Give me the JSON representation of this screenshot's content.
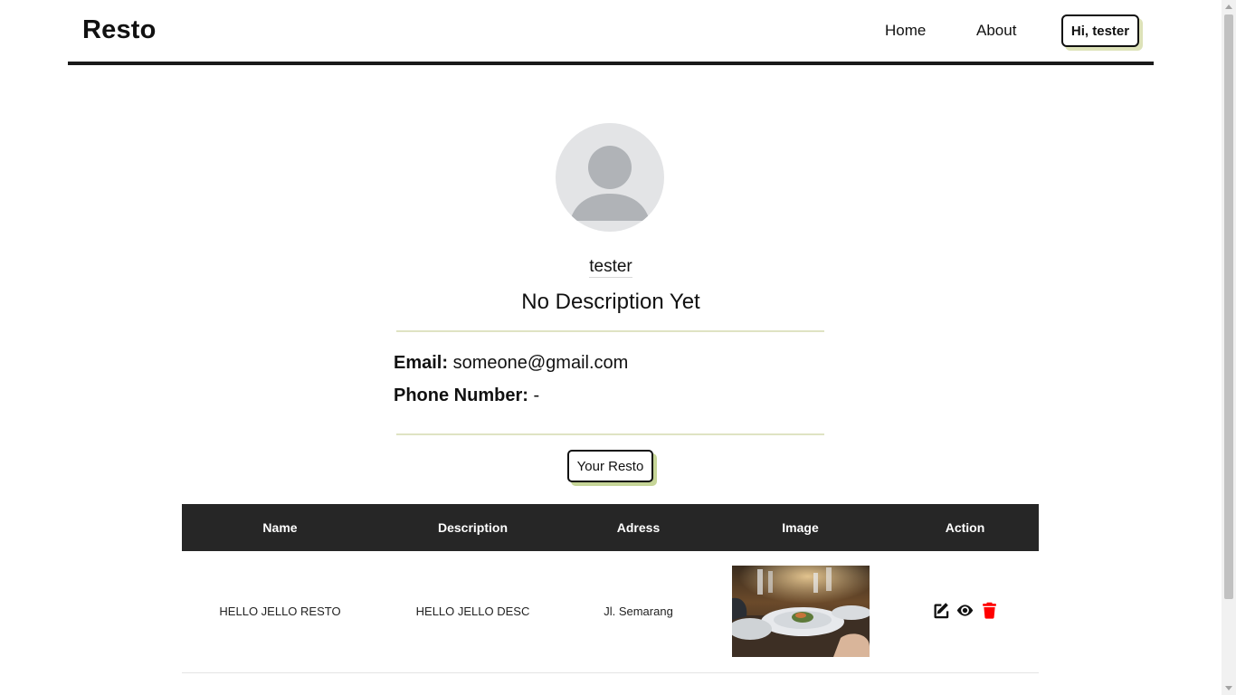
{
  "navbar": {
    "brand": "Resto",
    "links": [
      "Home",
      "About"
    ],
    "user_button": "Hi, tester"
  },
  "profile": {
    "username": "tester",
    "description": "No Description Yet",
    "email_label": "Email:",
    "email_value": "someone@gmail.com",
    "phone_label": "Phone Number:",
    "phone_value": "-",
    "resto_button": "Your Resto"
  },
  "table": {
    "headers": [
      "Name",
      "Description",
      "Adress",
      "Image",
      "Action"
    ],
    "rows": [
      {
        "name": "HELLO JELLO RESTO",
        "description": "HELLO JELLO DESC",
        "address": "Jl. Semarang",
        "image": "restaurant-food-photo",
        "actions": [
          "edit-icon",
          "view-icon",
          "delete-icon"
        ]
      }
    ]
  },
  "colors": {
    "header_bg": "#262626",
    "delete": "#ff0000",
    "accent_shadow": "#c6d597",
    "divider": "#dfe3c3"
  }
}
